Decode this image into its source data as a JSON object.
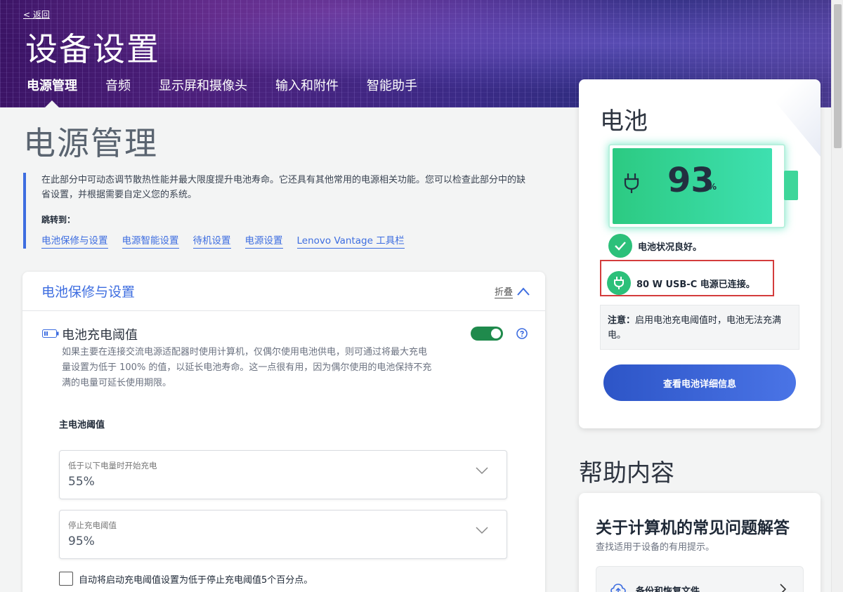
{
  "header": {
    "back_label": "< 返回",
    "title": "设备设置",
    "tabs": [
      {
        "label": "电源管理",
        "active": true
      },
      {
        "label": "音频"
      },
      {
        "label": "显示屏和摄像头"
      },
      {
        "label": "输入和附件"
      },
      {
        "label": "智能助手"
      }
    ]
  },
  "main": {
    "title": "电源管理",
    "intro": "在此部分中可动态调节散热性能并最大限度提升电池寿命。它还具有其他常用的电源相关功能。您可以检查此部分中的缺省设置，并根据需要自定义您的系统。",
    "jump_label": "跳转到：",
    "jump_links": [
      "电池保修与设置",
      "电源智能设置",
      "待机设置",
      "电源设置",
      "Lenovo Vantage 工具栏"
    ]
  },
  "card": {
    "title": "电池保修与设置",
    "collapse_label": "折叠",
    "setting_name": "电池充电阈值",
    "toggle_on": true,
    "setting_desc": "如果主要在连接交流电源适配器时使用计算机，仅偶尔使用电池供电，则可通过将最大充电量设置为低于 100% 的值，以延长电池寿命。这一点很有用，因为偶尔使用的电池保持不充满的电量可延长使用期限。",
    "sub_title": "主电池阈值",
    "start_label": "低于以下电量时开始充电",
    "start_value": "55%",
    "stop_label": "停止充电阈值",
    "stop_value": "95%",
    "checkbox_label": "自动将启动充电阈值设置为低于停止充电阈值5个百分点。",
    "checkbox_checked": false
  },
  "battery": {
    "title": "电池",
    "percent": "93",
    "percent_unit": "%",
    "level": 0.93,
    "status_text": "电池状况良好。",
    "power_text": "80 W USB-C 电源已连接。",
    "note_label": "注意：",
    "note_text": "启用电池充电阈值时，电池无法充满电。",
    "detail_button": "查看电池详细信息"
  },
  "help": {
    "title": "帮助内容",
    "faq_title": "关于计算机的常见问题解答",
    "faq_sub": "查找适用于设备的有用提示。",
    "faq_item": "备份和恢复文件"
  },
  "colors": {
    "accent": "#3d6de0",
    "toggle_on": "#1f8a4c",
    "battery_green": "#2cca82",
    "status_green": "#2cc07a",
    "highlight_red": "#d43c3c",
    "button_blue": "#2d55c7"
  }
}
